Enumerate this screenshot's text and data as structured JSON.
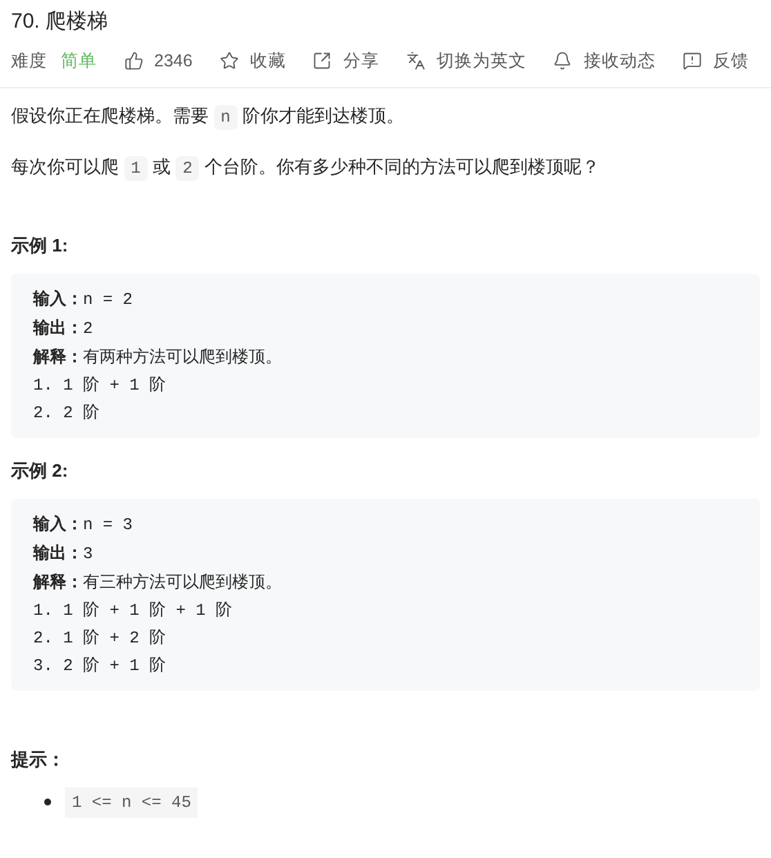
{
  "title": "70. 爬楼梯",
  "meta": {
    "difficulty_label": "难度",
    "difficulty": "简单"
  },
  "actions": [
    {
      "label": "2346"
    },
    {
      "label": "收藏"
    },
    {
      "label": "分享"
    },
    {
      "label": "切换为英文"
    },
    {
      "label": "接收动态"
    },
    {
      "label": "反馈"
    }
  ],
  "description": [
    [
      {
        "kind": "text",
        "text": "假设你正在爬楼梯。需要 "
      },
      {
        "kind": "code",
        "text": "n"
      },
      {
        "kind": "text",
        "text": " 阶你才能到达楼顶。"
      }
    ],
    [
      {
        "kind": "text",
        "text": "每次你可以爬 "
      },
      {
        "kind": "code",
        "text": "1"
      },
      {
        "kind": "text",
        "text": " 或 "
      },
      {
        "kind": "code",
        "text": "2"
      },
      {
        "kind": "text",
        "text": " 个台阶。你有多少种不同的方法可以爬到楼顶呢？"
      }
    ]
  ],
  "examples": [
    {
      "heading": "示例 1:",
      "lines": [
        {
          "label": "输入：",
          "value": "n = 2"
        },
        {
          "label": "输出：",
          "value": "2"
        },
        {
          "label": "解释：",
          "value": "有两种方法可以爬到楼顶。"
        },
        {
          "value": "1. 1 阶 + 1 阶"
        },
        {
          "value": "2. 2 阶"
        }
      ]
    },
    {
      "heading": "示例 2:",
      "lines": [
        {
          "label": "输入：",
          "value": "n = 3"
        },
        {
          "label": "输出：",
          "value": "3"
        },
        {
          "label": "解释：",
          "value": "有三种方法可以爬到楼顶。"
        },
        {
          "value": "1. 1 阶 + 1 阶 + 1 阶"
        },
        {
          "value": "2. 1 阶 + 2 阶"
        },
        {
          "value": "3. 2 阶 + 1 阶"
        }
      ]
    }
  ],
  "hints": {
    "heading": "提示：",
    "items": [
      "1 <= n <= 45"
    ]
  }
}
